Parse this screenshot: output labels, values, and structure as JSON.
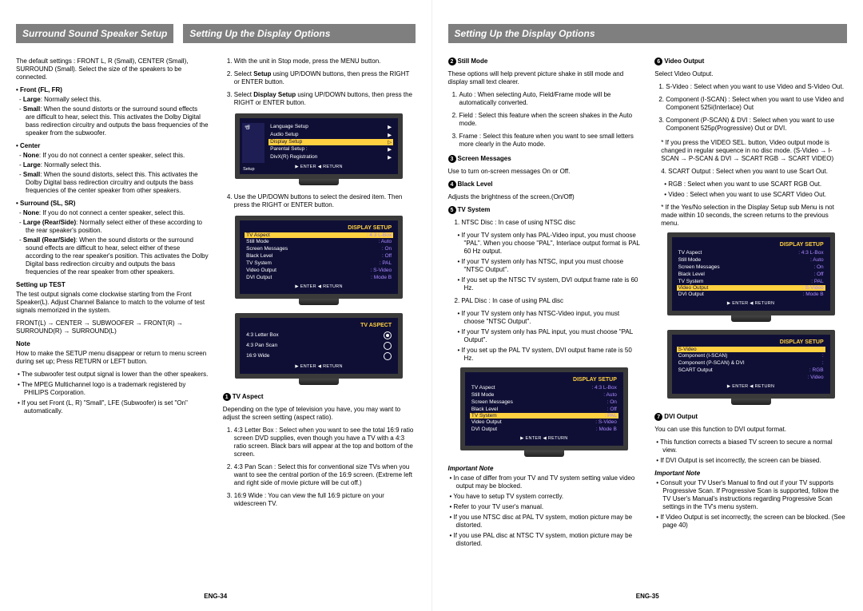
{
  "headers": {
    "left1": "Surround Sound Speaker Setup",
    "left2": "Setting Up the Display Options",
    "right": "Setting Up the Display Options"
  },
  "col1": {
    "intro": "The default settings : FRONT L, R (Small), CENTER (Small), SURROUND (Small).\nSelect the size of the speakers to be connected.",
    "front_h": "• Front (FL, FR)",
    "front": [
      "Large: Normally select this.",
      "Small: When the sound distorts or the surround sound effects are difficult to hear, select this. This activates the Dolby Digital bass redirection circuitry and outputs the bass frequencies of the speaker from the subwoofer."
    ],
    "center_h": "• Center",
    "center": [
      "None: If you do not connect a center speaker, select this.",
      "Large: Normally select this.",
      "Small: When the sound distorts, select this. This activates the Dolby Digital bass redirection circuitry and outputs the bass frequencies of the center speaker from other speakers."
    ],
    "surround_h": "• Surround (SL, SR)",
    "surround": [
      "None: If you do not connect a center speaker, select this.",
      "Large (Rear/Side): Normally select either of these according to the rear speaker's position.",
      "Small (Rear/Side): When the sound distorts or the surround sound effects are difficult to hear, select either of these according to the rear speaker's position. This activates the Dolby Digital bass redirection circuitry and outputs the bass frequencies of the rear speaker from other speakers."
    ],
    "test_h": "Setting up TEST",
    "test_p": "The test output signals come clockwise starting from the Front Speaker(L). Adjust Channel Balance to match to the volume of test signals memorized in the system.",
    "test_chain": "FRONT(L) → CENTER → SUBWOOFER → FRONT(R) → SURROUND(R) → SURROUND(L)",
    "note_h": "Note",
    "note_p": "How to make the SETUP menu disappear or return to menu screen during set up; Press RETURN or LEFT button.",
    "notes": [
      "The subwoofer test output signal is lower than the other speakers.",
      "The MPEG Multichannel logo is a trademark registered by PHILIPS Corporation.",
      "If you set Front (L, R) \"Small\", LFE (Subwoofer) is set \"On\" automatically."
    ]
  },
  "col2": {
    "steps": [
      "With the unit in Stop mode, press the MENU button.",
      "Select Setup using UP/DOWN buttons, then press the RIGHT or ENTER button.",
      "Select Display Setup using UP/DOWN buttons, then press the RIGHT or ENTER button."
    ],
    "step4": "Use the UP/DOWN buttons to select the desired item. Then press the RIGHT or ENTER button.",
    "menu1": {
      "items": [
        "Language Setup",
        "Audio Setup",
        "Display Setup",
        "Parental Setup :",
        "DivX(R) Registration"
      ],
      "hi": 2,
      "side": "Setup",
      "foot": "▶ ENTER    ◀ RETURN"
    },
    "menu2": {
      "title": "DISPLAY SETUP",
      "rows": [
        [
          "TV Aspect",
          "4:3 L-Box"
        ],
        [
          "Still Mode",
          "Auto"
        ],
        [
          "Screen Messages",
          "On"
        ],
        [
          "Black Level",
          "Off"
        ],
        [
          "TV System",
          "PAL"
        ],
        [
          "Video Output",
          "S-Video"
        ],
        [
          "DVI Output",
          "Mode B"
        ]
      ],
      "hi": 0,
      "foot": "▶ ENTER    ◀ RETURN"
    },
    "menu3": {
      "title": "TV ASPECT",
      "rows": [
        "4:3 Letter Box",
        "4:3 Pan Scan",
        "16:9 Wide"
      ],
      "sel": 0,
      "foot": "▶ ENTER    ◀ RETURN"
    },
    "tv_aspect_h": "TV Aspect",
    "tv_aspect_intro": "Depending on the type of television you have, you may want to adjust the screen setting (aspect ratio).",
    "tv_aspect_items": [
      "4:3 Letter Box : Select when you want to see the total 16:9 ratio screen DVD supplies, even though you have a TV with a 4:3 ratio screen. Black bars will appear at the top and bottom of the screen.",
      "4:3 Pan Scan : Select this for conventional size TVs when you want to see the central portion of the 16:9 screen. (Extreme left and right side of movie picture will be cut off.)",
      "16:9 Wide : You can view the full 16:9 picture on your widescreen TV."
    ]
  },
  "col3": {
    "still_h": "Still Mode",
    "still_intro": "These options will help prevent picture shake in still mode and display small text clearer.",
    "still_items": [
      "Auto : When selecting Auto, Field/Frame mode will be automatically converted.",
      "Field : Select this feature when the screen shakes in the Auto mode.",
      "Frame : Select this feature when you want to see small letters more clearly in the Auto mode."
    ],
    "scrmsg_h": "Screen Messages",
    "scrmsg": "Use to turn on-screen messages On or Off.",
    "black_h": "Black Level",
    "black": "Adjusts the brightness of the screen.(On/Off)",
    "tvsys_h": "TV System",
    "ntsc_lead": "NTSC Disc : In case of using NTSC disc",
    "ntsc": [
      "If your TV system only has PAL-Video input, you must choose \"PAL\". When you choose \"PAL\", Interlace output format is PAL 60 Hz output.",
      "If your TV system only has NTSC, input you must choose \"NTSC Output\".",
      "If you set up the NTSC TV system, DVI output frame rate is 60 Hz."
    ],
    "pal_lead": "PAL Disc : In case of using PAL disc",
    "pal": [
      "If your TV system only has NTSC-Video input, you must choose \"NTSC Output\".",
      "If your TV system only has PAL input, you must choose \"PAL Output\".",
      "If you set up the PAL TV system, DVI output frame rate is 50 Hz."
    ],
    "menu": {
      "title": "DISPLAY SETUP",
      "rows": [
        [
          "TV Aspect",
          "4:3 L-Box"
        ],
        [
          "Still Mode",
          "Auto"
        ],
        [
          "Screen Messages",
          "On"
        ],
        [
          "Black Level",
          "Off"
        ],
        [
          "TV System",
          "PAL"
        ],
        [
          "Video Output",
          "S-Video"
        ],
        [
          "DVI Output",
          "Mode B"
        ]
      ],
      "hi": 4,
      "foot": "▶ ENTER    ◀ RETURN"
    },
    "imp_h": "Important Note",
    "imp": [
      "In case of differ from your TV and TV system setting value video output may be blocked.",
      "You have to setup TV system correctly.",
      "Refer to your TV user's manual.",
      "If you use NTSC disc at PAL TV system, motion picture may be distorted.",
      "If you use PAL disc at NTSC TV system, motion picture may be distorted."
    ]
  },
  "col4": {
    "vout_h": "Video Output",
    "vout_lead": "Select Video Output.",
    "vout_items": [
      "S-Video : Select when you want to use Video and S-Video Out.",
      "Component (I-SCAN) : Select when you want to use Video and Component 525i(Interlace) Out",
      "Component (P-SCAN) & DVI : Select when you want to use Component 525p(Progressive) Out or DVI."
    ],
    "vout_star": "* If you press the VIDEO SEL. button, Video output mode is changed in regular sequence in no disc mode. (S-Video → I-SCAN → P-SCAN & DVI → SCART RGB → SCART VIDEO)",
    "scart_lead": "SCART Output : Select when you want to use Scart Out.",
    "scart": [
      "RGB : Select when you want to use SCART RGB Out.",
      "Video : Select when you want to use SCART Video Out."
    ],
    "yesno": "* If the Yes/No selection in the Display Setup sub Menu is not made within 10 seconds, the screen returns to the previous menu.",
    "menu1": {
      "title": "DISPLAY SETUP",
      "rows": [
        [
          "TV Aspect",
          "4:3 L-Box"
        ],
        [
          "Still Mode",
          "Auto"
        ],
        [
          "Screen Messages",
          "On"
        ],
        [
          "Black Level",
          "Off"
        ],
        [
          "TV System",
          "PAL"
        ],
        [
          "Video Output",
          "S-Video"
        ],
        [
          "DVI Output",
          "Mode B"
        ]
      ],
      "hi": 5,
      "foot": "▶ ENTER    ◀ RETURN"
    },
    "menu2": {
      "title": "DISPLAY SETUP",
      "rows": [
        [
          "S-Video",
          ""
        ],
        [
          "Component (I-SCAN)",
          ""
        ],
        [
          "Component (P-SCAN) & DVI",
          ""
        ],
        [
          "SCART Output",
          "RGB"
        ],
        [
          "",
          "Video"
        ]
      ],
      "hi": 0,
      "foot": "▶ ENTER    ◀ RETURN"
    },
    "dvi_h": "DVI Output",
    "dvi_intro": "You can use this function to DVI output format.",
    "dvi_items": [
      "This function corrects a biased TV screen to secure a normal view.",
      "If DVI Output is set incorrectly, the screen can be biased."
    ],
    "imp_h": "Important Note",
    "imp": [
      "Consult your TV User's Manual to find out if your TV supports Progressive Scan. If Progressive Scan is supported, follow the TV User's Manual's instructions regarding Progressive Scan settings in the TV's menu system.",
      "If Video Output is set incorrectly, the screen can be blocked. (See page 40)"
    ]
  },
  "pg": {
    "left": "ENG-34",
    "right": "ENG-35"
  }
}
